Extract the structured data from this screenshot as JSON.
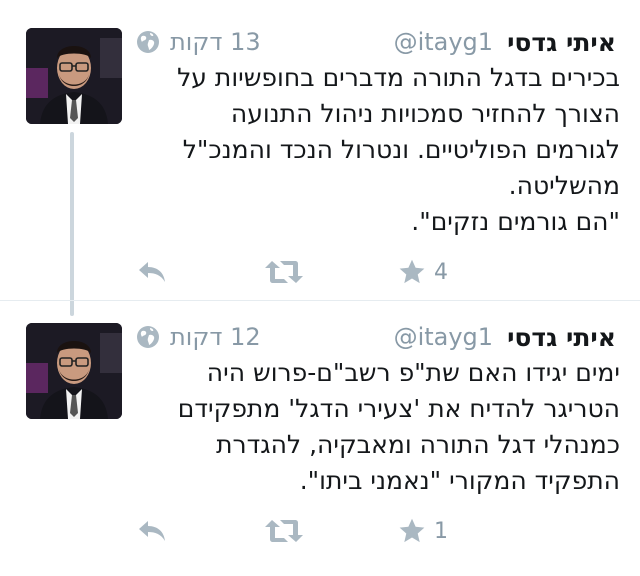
{
  "colors": {
    "name": "#14171a",
    "meta": "#8899a6",
    "icon": "#aab8c2",
    "thread_line": "#ccd6dd"
  },
  "tweets": [
    {
      "author_name": "איתי גדסי",
      "handle": "@itayg1",
      "time": "13 דקות",
      "time_icon": "globe-icon",
      "text_lines": [
        "בכירים בדגל התורה מדברים בחופשיות על",
        "הצורך להחזיר סמכויות ניהול התנועה",
        "לגורמים הפוליטיים. ונטרול הנכד והמנכ\"ל",
        "מהשליטה.",
        "\"הם גורמים נזקים\"."
      ],
      "favorites": "4"
    },
    {
      "author_name": "איתי גדסי",
      "handle": "@itayg1",
      "time": "12 דקות",
      "time_icon": "globe-icon",
      "text_lines": [
        "ימים יגידו האם שת\"פ רשב\"ם-פרוש היה",
        "הטריגר להדיח את 'צעירי הדגל' מתפקידם",
        "כמנהלי דגל התורה ומאבקיה, להגדרת",
        "התפקיד המקורי \"נאמני ביתו\"."
      ],
      "favorites": "1"
    }
  ]
}
